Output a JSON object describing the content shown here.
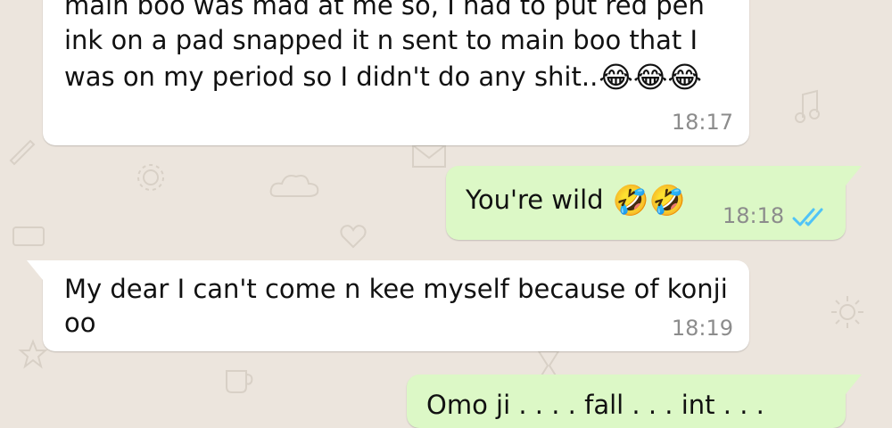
{
  "messages": [
    {
      "direction": "incoming",
      "lines": [
        "main boo was mad at me so, I had to put red pen",
        "ink on a pad snapped it n sent to main boo that I",
        "was on my period so I didn't do any shit.."
      ],
      "emoji": "😂😂😂",
      "time": "18:17"
    },
    {
      "direction": "outgoing",
      "text": "You're wild",
      "emoji": "🤣🤣",
      "time": "18:18",
      "status": "read",
      "status_icon": "double-check-icon",
      "status_color": "#4fc3f7"
    },
    {
      "direction": "incoming",
      "lines": [
        "My dear I can't come n kee myself because of konji",
        "oo"
      ],
      "time": "18:19"
    },
    {
      "direction": "outgoing",
      "text": "Omo ji . . . . fall . . . int . . ."
    }
  ],
  "colors": {
    "wallpaper": "#ece5dd",
    "incoming_bubble": "#ffffff",
    "outgoing_bubble": "#dcf8c6",
    "timestamp": "#8c8c8c"
  }
}
